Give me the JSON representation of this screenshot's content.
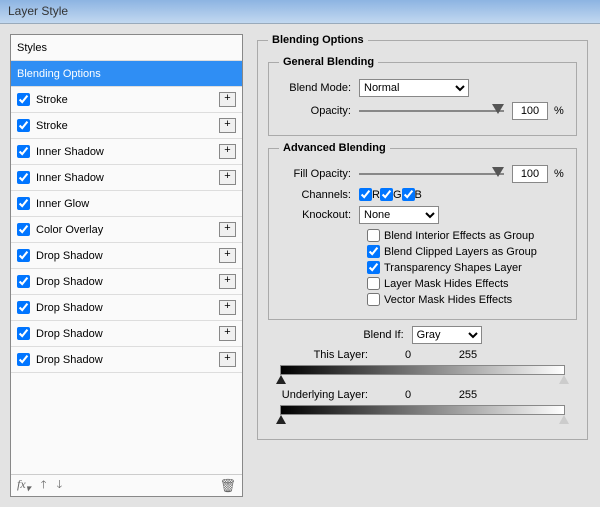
{
  "window": {
    "title": "Layer Style"
  },
  "styles_header": "Styles",
  "styles": [
    {
      "label": "Blending Options",
      "checked": null,
      "add": false,
      "selected": true
    },
    {
      "label": "Stroke",
      "checked": true,
      "add": true
    },
    {
      "label": "Stroke",
      "checked": true,
      "add": true
    },
    {
      "label": "Inner Shadow",
      "checked": true,
      "add": true
    },
    {
      "label": "Inner Shadow",
      "checked": true,
      "add": true
    },
    {
      "label": "Inner Glow",
      "checked": true,
      "add": false
    },
    {
      "label": "Color Overlay",
      "checked": true,
      "add": true
    },
    {
      "label": "Drop Shadow",
      "checked": true,
      "add": true
    },
    {
      "label": "Drop Shadow",
      "checked": true,
      "add": true
    },
    {
      "label": "Drop Shadow",
      "checked": true,
      "add": true
    },
    {
      "label": "Drop Shadow",
      "checked": true,
      "add": true
    },
    {
      "label": "Drop Shadow",
      "checked": true,
      "add": true
    }
  ],
  "sections": {
    "blending_options": "Blending Options",
    "general": "General Blending",
    "advanced": "Advanced Blending"
  },
  "labels": {
    "blend_mode": "Blend Mode:",
    "opacity": "Opacity:",
    "fill_opacity": "Fill Opacity:",
    "channels": "Channels:",
    "knockout": "Knockout:",
    "blend_if": "Blend If:",
    "this_layer": "This Layer:",
    "underlying": "Underlying Layer:",
    "percent": "%"
  },
  "values": {
    "blend_mode": "Normal",
    "opacity": "100",
    "fill_opacity": "100",
    "knockout": "None",
    "blend_if": "Gray",
    "this_low": "0",
    "this_high": "255",
    "under_low": "0",
    "under_high": "255"
  },
  "channels": {
    "r": "R",
    "g": "G",
    "b": "B",
    "r_on": true,
    "g_on": true,
    "b_on": true
  },
  "adv_checks": [
    {
      "label": "Blend Interior Effects as Group",
      "on": false
    },
    {
      "label": "Blend Clipped Layers as Group",
      "on": true
    },
    {
      "label": "Transparency Shapes Layer",
      "on": true
    },
    {
      "label": "Layer Mask Hides Effects",
      "on": false
    },
    {
      "label": "Vector Mask Hides Effects",
      "on": false
    }
  ],
  "add_glyph": "+"
}
